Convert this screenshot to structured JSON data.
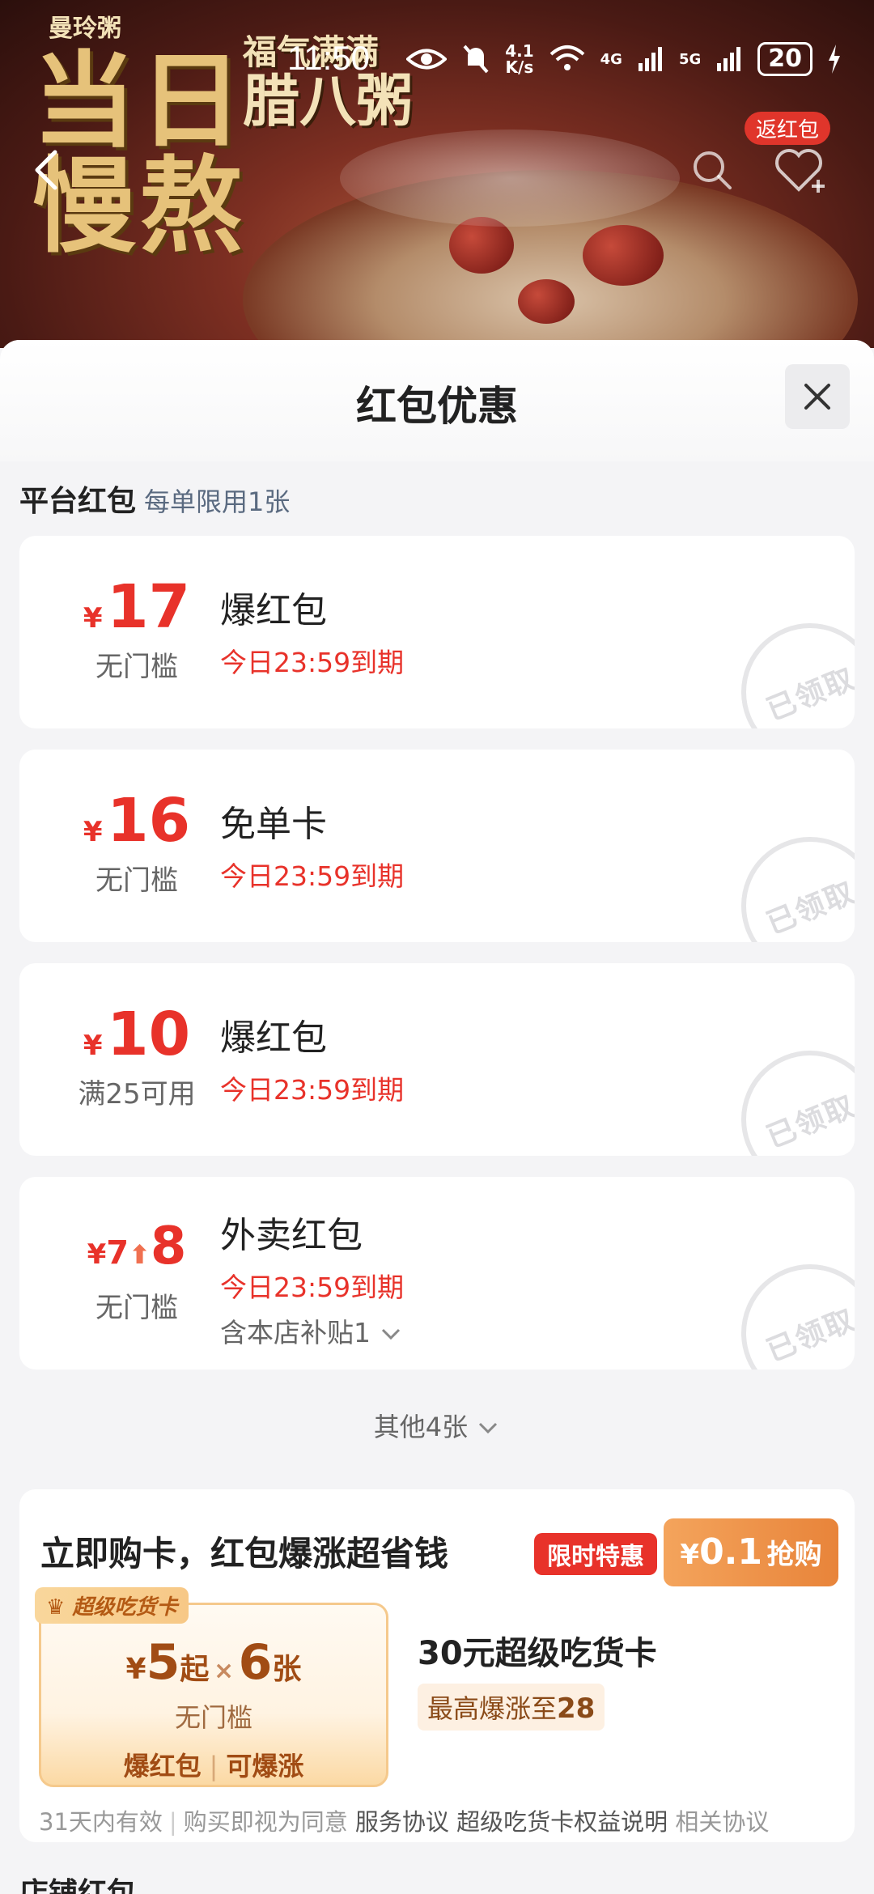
{
  "status_bar": {
    "time": "11:50",
    "net_speed": "4.1\nK/s",
    "signal_4g": "4G",
    "signal_5g": "5G",
    "battery": "20"
  },
  "banner": {
    "brand": "曼玲粥",
    "slogan_small": "福气满满",
    "slogan_main": "腊八粥",
    "headline": "当日\n慢熬",
    "return_badge": "返红包"
  },
  "sheet": {
    "title": "红包优惠",
    "section_title": "平台红包",
    "section_sub": "每单限用1张",
    "coupons": [
      {
        "yen": "¥",
        "amount": "17",
        "condition": "无门槛",
        "title": "爆红包",
        "expire": "今日23:59到期",
        "stamp": "已领取"
      },
      {
        "yen": "¥",
        "amount": "16",
        "condition": "无门槛",
        "title": "免单卡",
        "expire": "今日23:59到期",
        "stamp": "已领取"
      },
      {
        "yen": "¥",
        "amount": "10",
        "condition": "满25可用",
        "title": "爆红包",
        "expire": "今日23:59到期",
        "stamp": "已领取"
      },
      {
        "yen": "¥",
        "old_amount": "7",
        "amount": "8",
        "condition": "无门槛",
        "title": "外卖红包",
        "expire": "今日23:59到期",
        "sub": "含本店补贴1",
        "stamp": "已领取"
      }
    ],
    "others": "其他4张"
  },
  "buy_card": {
    "title": "立即购卡，红包爆涨超省钱",
    "limited": "限时特惠",
    "price_yen": "¥",
    "price": "0.1",
    "grab": "抢购",
    "badge": "超级吃货卡",
    "value_yen": "¥",
    "value_amount": "5",
    "value_from": "起",
    "value_times": "×",
    "value_count": "6",
    "value_unit": "张",
    "condition": "无门槛",
    "tag1": "爆红包",
    "tag2": "可爆涨",
    "card_name": "30元超级吃货卡",
    "boost_prefix": "最高爆涨至",
    "boost_value": "28",
    "terms_valid": "31天内有效",
    "terms_agree": "购买即视为同意",
    "terms_link1": "服务协议",
    "terms_link2": "超级吃货卡权益说明",
    "terms_link3": "相关协议"
  },
  "store_title": "店铺红包"
}
